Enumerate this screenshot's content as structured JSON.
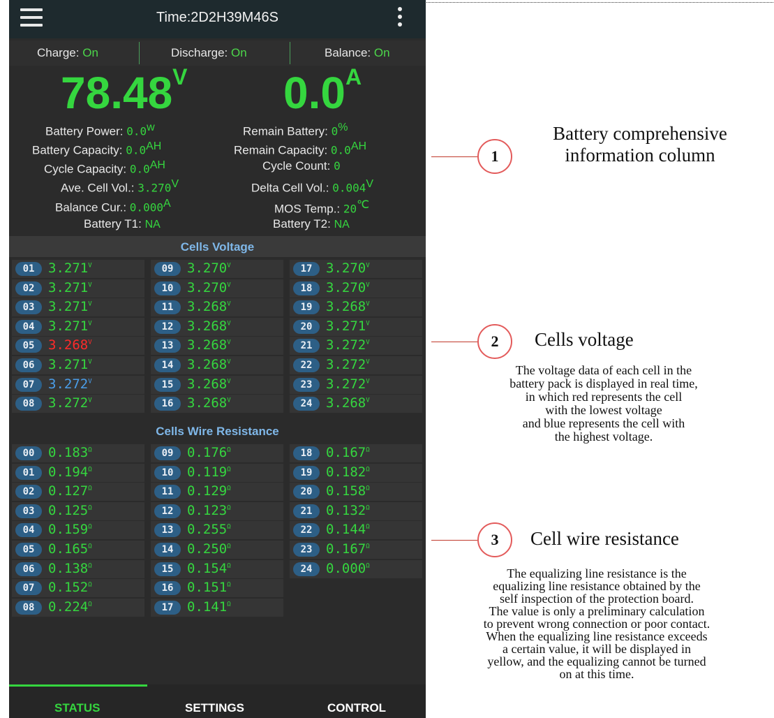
{
  "app": {
    "title": "Time:2D2H39M46S"
  },
  "status": {
    "charge_label": "Charge:",
    "charge_value": "On",
    "discharge_label": "Discharge:",
    "discharge_value": "On",
    "balance_label": "Balance:",
    "balance_value": "On"
  },
  "summary": {
    "voltage": "78.48",
    "voltage_unit": "V",
    "current": "0.0",
    "current_unit": "A"
  },
  "info": {
    "battery_power_label": "Battery Power:",
    "battery_power": "0.0",
    "battery_power_unit": "w",
    "remain_battery_label": "Remain Battery:",
    "remain_battery": "0",
    "remain_battery_unit": "%",
    "battery_capacity_label": "Battery Capacity:",
    "battery_capacity": "0.0",
    "battery_capacity_unit": "AH",
    "remain_capacity_label": "Remain Capacity:",
    "remain_capacity": "0.0",
    "remain_capacity_unit": "AH",
    "cycle_capacity_label": "Cycle Capacity:",
    "cycle_capacity": "0.0",
    "cycle_capacity_unit": "AH",
    "cycle_count_label": "Cycle Count:",
    "cycle_count": "0",
    "ave_cell_label": "Ave. Cell Vol.:",
    "ave_cell": "3.270",
    "ave_cell_unit": "V",
    "delta_cell_label": "Delta Cell Vol.:",
    "delta_cell": "0.004",
    "delta_cell_unit": "V",
    "balance_cur_label": "Balance Cur.:",
    "balance_cur": "0.000",
    "balance_cur_unit": "A",
    "mos_temp_label": "MOS Temp.:",
    "mos_temp": "20",
    "mos_temp_unit": "℃",
    "t1_label": "Battery T1:",
    "t1": "NA",
    "t2_label": "Battery T2:",
    "t2": "NA"
  },
  "cells_voltage": {
    "title": "Cells Voltage",
    "unit": "V",
    "items": [
      {
        "id": "01",
        "value": "3.271",
        "color": "#35d63f"
      },
      {
        "id": "02",
        "value": "3.271",
        "color": "#35d63f"
      },
      {
        "id": "03",
        "value": "3.271",
        "color": "#35d63f"
      },
      {
        "id": "04",
        "value": "3.271",
        "color": "#35d63f"
      },
      {
        "id": "05",
        "value": "3.268",
        "color": "#ff2a2a"
      },
      {
        "id": "06",
        "value": "3.271",
        "color": "#35d63f"
      },
      {
        "id": "07",
        "value": "3.272",
        "color": "#4a9de8"
      },
      {
        "id": "08",
        "value": "3.272",
        "color": "#35d63f"
      },
      {
        "id": "09",
        "value": "3.270",
        "color": "#35d63f"
      },
      {
        "id": "10",
        "value": "3.270",
        "color": "#35d63f"
      },
      {
        "id": "11",
        "value": "3.268",
        "color": "#35d63f"
      },
      {
        "id": "12",
        "value": "3.268",
        "color": "#35d63f"
      },
      {
        "id": "13",
        "value": "3.268",
        "color": "#35d63f"
      },
      {
        "id": "14",
        "value": "3.268",
        "color": "#35d63f"
      },
      {
        "id": "15",
        "value": "3.268",
        "color": "#35d63f"
      },
      {
        "id": "16",
        "value": "3.268",
        "color": "#35d63f"
      },
      {
        "id": "17",
        "value": "3.270",
        "color": "#35d63f"
      },
      {
        "id": "18",
        "value": "3.270",
        "color": "#35d63f"
      },
      {
        "id": "19",
        "value": "3.268",
        "color": "#35d63f"
      },
      {
        "id": "20",
        "value": "3.271",
        "color": "#35d63f"
      },
      {
        "id": "21",
        "value": "3.272",
        "color": "#35d63f"
      },
      {
        "id": "22",
        "value": "3.272",
        "color": "#35d63f"
      },
      {
        "id": "23",
        "value": "3.272",
        "color": "#35d63f"
      },
      {
        "id": "24",
        "value": "3.268",
        "color": "#35d63f"
      }
    ]
  },
  "wire_resistance": {
    "title": "Cells Wire Resistance",
    "unit": "Ω",
    "items": [
      {
        "id": "00",
        "value": "0.183"
      },
      {
        "id": "01",
        "value": "0.194"
      },
      {
        "id": "02",
        "value": "0.127"
      },
      {
        "id": "03",
        "value": "0.125"
      },
      {
        "id": "04",
        "value": "0.159"
      },
      {
        "id": "05",
        "value": "0.165"
      },
      {
        "id": "06",
        "value": "0.138"
      },
      {
        "id": "07",
        "value": "0.152"
      },
      {
        "id": "08",
        "value": "0.224"
      },
      {
        "id": "09",
        "value": "0.176"
      },
      {
        "id": "10",
        "value": "0.119"
      },
      {
        "id": "11",
        "value": "0.129"
      },
      {
        "id": "12",
        "value": "0.123"
      },
      {
        "id": "13",
        "value": "0.255"
      },
      {
        "id": "14",
        "value": "0.250"
      },
      {
        "id": "15",
        "value": "0.154"
      },
      {
        "id": "16",
        "value": "0.151"
      },
      {
        "id": "17",
        "value": "0.141"
      },
      {
        "id": "18",
        "value": "0.167"
      },
      {
        "id": "19",
        "value": "0.182"
      },
      {
        "id": "20",
        "value": "0.158"
      },
      {
        "id": "21",
        "value": "0.132"
      },
      {
        "id": "22",
        "value": "0.144"
      },
      {
        "id": "23",
        "value": "0.167"
      },
      {
        "id": "24",
        "value": "0.000"
      }
    ]
  },
  "tabs": {
    "status": "STATUS",
    "settings": "SETTINGS",
    "control": "CONTROL"
  },
  "annotations": {
    "a1": {
      "num": "1",
      "line1": "Battery comprehensive",
      "line2": "information column"
    },
    "a2": {
      "num": "2",
      "title": "Cells voltage",
      "body": [
        "The voltage data of each cell in the",
        "battery pack is displayed in real time,",
        "in which red represents the cell",
        "with the lowest voltage",
        "and blue represents the cell with",
        "the highest voltage."
      ]
    },
    "a3": {
      "num": "3",
      "title": "Cell wire resistance",
      "body": [
        "The equalizing line resistance is the",
        "equalizing line resistance obtained by the",
        "self inspection of the protection board.",
        "The value is only a preliminary calculation",
        "to prevent wrong connection or poor contact.",
        "When the equalizing line resistance exceeds",
        "a certain value, it will be displayed in",
        "yellow, and the equalizing cannot be turned",
        "on at this time."
      ]
    }
  },
  "colors": {
    "accent": "#35d63f",
    "lowest": "#ff2a2a",
    "highest": "#4a9de8",
    "badge": "#2d5f86",
    "section": "#7fb7e8"
  }
}
